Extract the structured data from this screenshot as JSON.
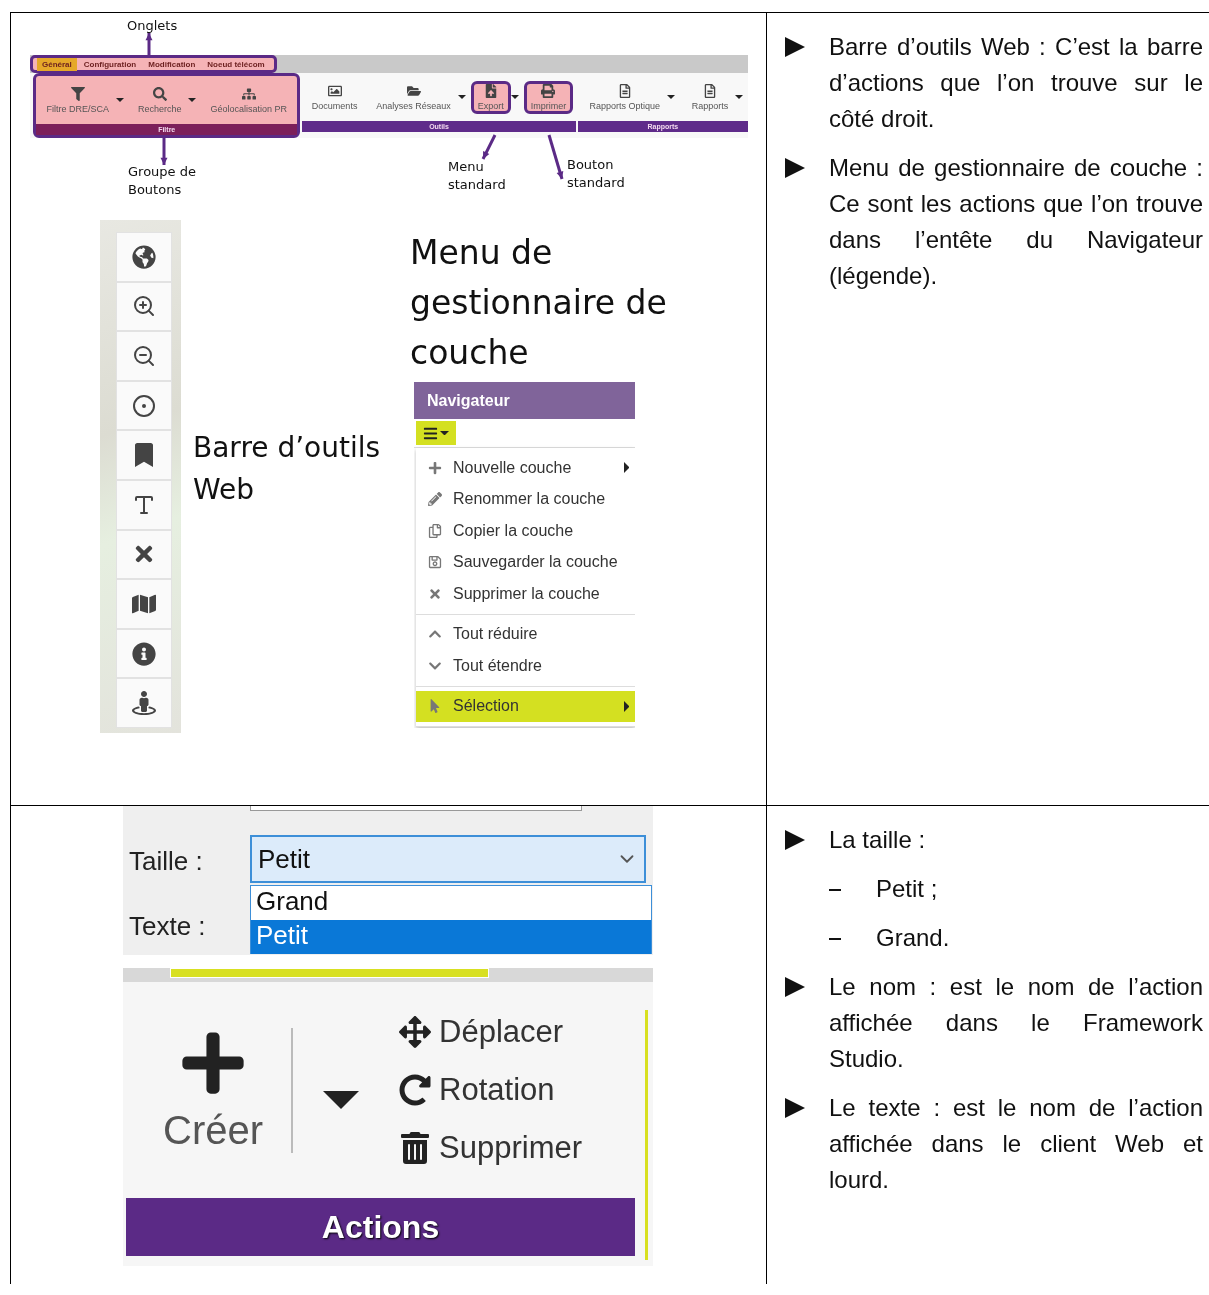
{
  "section_1": {
    "toolbar": {
      "tabs": [
        {
          "label": "Général",
          "selected": true
        },
        {
          "label": "Configuration",
          "selected": false
        },
        {
          "label": "Modification",
          "selected": false
        },
        {
          "label": "Noeud télécom",
          "selected": false
        }
      ],
      "groups": [
        {
          "label": "Filtre",
          "highlighted": true,
          "buttons": [
            {
              "label": "Filtre DRE/SCA",
              "dropdown": true,
              "highlighted": false
            },
            {
              "label": "Recherche",
              "dropdown": true,
              "highlighted": false
            },
            {
              "label": "Géolocalisation PR",
              "dropdown": false,
              "highlighted": false
            }
          ]
        },
        {
          "label": "Outils",
          "highlighted": false,
          "buttons": [
            {
              "label": "Documents",
              "dropdown": false,
              "highlighted": false
            },
            {
              "label": "Analyses Réseaux",
              "dropdown": true,
              "highlighted": false
            },
            {
              "label": "Export",
              "dropdown": true,
              "highlighted": true
            },
            {
              "label": "Imprimer",
              "dropdown": false,
              "highlighted": true
            }
          ]
        },
        {
          "label": "Rapports",
          "highlighted": false,
          "buttons": [
            {
              "label": "Rapports Optique",
              "dropdown": true,
              "highlighted": false
            },
            {
              "label": "Rapports",
              "dropdown": true,
              "highlighted": false
            }
          ]
        }
      ]
    },
    "callouts": {
      "tabs": "Onglets",
      "button_group": "Groupe de Boutons",
      "standard_menu": "Menu standard",
      "standard_button": "Bouton standard",
      "layer_menu": "Menu de gestionnaire de couche",
      "web_toolbar": "Barre d’outils Web"
    },
    "layer_menu": {
      "title": "Navigateur",
      "sections": [
        [
          {
            "label": "Nouvelle couche",
            "submenu": true,
            "selected": false
          },
          {
            "label": "Renommer la couche",
            "submenu": false,
            "selected": false
          },
          {
            "label": "Copier la couche",
            "submenu": false,
            "selected": false
          },
          {
            "label": "Sauvegarder la couche",
            "submenu": false,
            "selected": false
          },
          {
            "label": "Supprimer la couche",
            "submenu": false,
            "selected": false
          }
        ],
        [
          {
            "label": "Tout réduire",
            "submenu": false,
            "selected": false
          },
          {
            "label": "Tout étendre",
            "submenu": false,
            "selected": false
          }
        ],
        [
          {
            "label": "Sélection",
            "submenu": true,
            "selected": true
          }
        ]
      ]
    },
    "description": [
      {
        "text": "Barre d’outils Web : C’est la barre d’actions que l’on trouve sur le côté droit."
      },
      {
        "text": "Menu de gestionnaire de couche : Ce sont les actions que l’on trouve dans l’entête du Navigateur (légende)."
      }
    ]
  },
  "section_2": {
    "size_form": {
      "size_label": "Taille :",
      "size_value": "Petit",
      "text_label": "Texte :",
      "options": [
        {
          "label": "Grand",
          "selected": false
        },
        {
          "label": "Petit",
          "selected": true
        }
      ]
    },
    "actions_group": {
      "create": "Créer",
      "items": [
        {
          "label": "Déplacer"
        },
        {
          "label": "Rotation"
        },
        {
          "label": "Supprimer"
        }
      ],
      "label": "Actions"
    },
    "description": [
      {
        "text": "La taille :",
        "children": [
          "Petit ;",
          "Grand."
        ]
      },
      {
        "text": "Le nom : est le nom de l’action affichée dans le Framework Studio."
      },
      {
        "text": "Le texte : est le nom de l’action affichée dans le client Web et lourd."
      }
    ]
  }
}
